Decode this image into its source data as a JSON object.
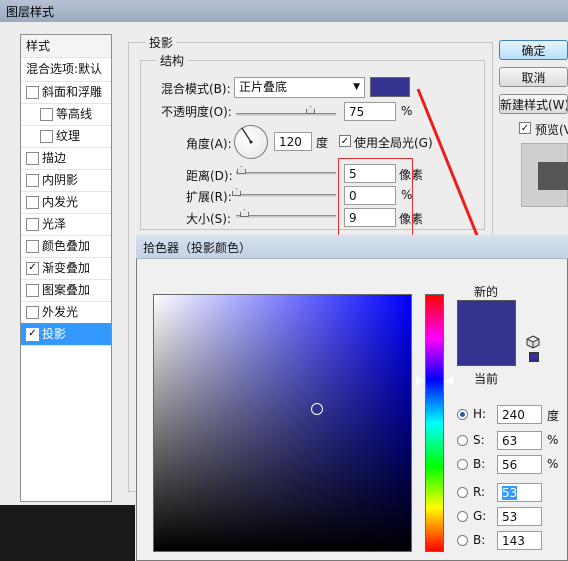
{
  "window": {
    "title": "图层样式"
  },
  "sidebar": {
    "header": "样式",
    "blend_default": "混合选项:默认",
    "items": [
      {
        "label": "斜面和浮雕",
        "checked": false,
        "indent": false
      },
      {
        "label": "等高线",
        "checked": false,
        "indent": true
      },
      {
        "label": "纹理",
        "checked": false,
        "indent": true
      },
      {
        "label": "描边",
        "checked": false,
        "indent": false
      },
      {
        "label": "内阴影",
        "checked": false,
        "indent": false
      },
      {
        "label": "内发光",
        "checked": false,
        "indent": false
      },
      {
        "label": "光泽",
        "checked": false,
        "indent": false
      },
      {
        "label": "颜色叠加",
        "checked": false,
        "indent": false
      },
      {
        "label": "渐变叠加",
        "checked": true,
        "indent": false
      },
      {
        "label": "图案叠加",
        "checked": false,
        "indent": false
      },
      {
        "label": "外发光",
        "checked": false,
        "indent": false
      },
      {
        "label": "投影",
        "checked": true,
        "indent": false,
        "selected": true
      }
    ]
  },
  "shadow": {
    "group_title": "投影",
    "structure_title": "结构",
    "blend_mode_label": "混合模式(B):",
    "blend_mode_value": "正片叠底",
    "shadow_color": "#343390",
    "opacity_label": "不透明度(O):",
    "opacity_value": "75",
    "opacity_percent": 75,
    "opacity_unit": "%",
    "angle_label": "角度(A):",
    "angle_value": "120",
    "angle_unit": "度",
    "global_light_label": "使用全局光(G)",
    "global_light_checked": true,
    "distance_label": "距离(D):",
    "distance_value": "5",
    "distance_unit": "像素",
    "spread_label": "扩展(R):",
    "spread_value": "0",
    "spread_unit": "%",
    "size_label": "大小(S):",
    "size_value": "9",
    "size_unit": "像素"
  },
  "buttons": {
    "ok": "确定",
    "cancel": "取消",
    "new_style": "新建样式(W)...",
    "preview_label": "预览(V)",
    "preview_checked": true
  },
  "picker": {
    "title": "拾色器（投影颜色）",
    "new_label": "新的",
    "current_label": "当前",
    "new_color": "#343390",
    "fields": [
      {
        "key": "H",
        "label": "H:",
        "value": "240",
        "unit": "度",
        "selected": true
      },
      {
        "key": "S",
        "label": "S:",
        "value": "63",
        "unit": "%",
        "selected": false
      },
      {
        "key": "Bv",
        "label": "B:",
        "value": "56",
        "unit": "%",
        "selected": false
      },
      {
        "key": "R",
        "label": "R:",
        "value": "53",
        "unit": "",
        "selected": false,
        "highlight": true
      },
      {
        "key": "G",
        "label": "G:",
        "value": "53",
        "unit": "",
        "selected": false
      },
      {
        "key": "B",
        "label": "B:",
        "value": "143",
        "unit": "",
        "selected": false
      }
    ]
  }
}
